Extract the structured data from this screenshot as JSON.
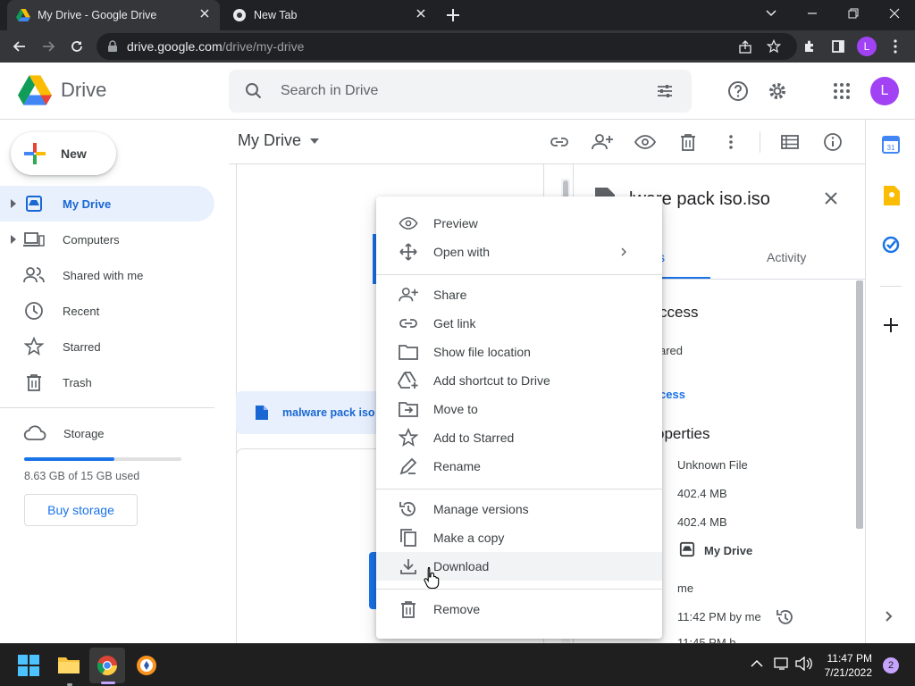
{
  "browser": {
    "tabs": [
      {
        "title": "My Drive - Google Drive"
      },
      {
        "title": "New Tab"
      }
    ],
    "url_host": "drive.google.com",
    "url_path": "/drive/my-drive",
    "profile_initial": "L"
  },
  "header": {
    "brand": "Drive",
    "search_placeholder": "Search in Drive",
    "avatar_initial": "L"
  },
  "sidebar": {
    "new_label": "New",
    "items": [
      {
        "label": "My Drive",
        "icon": "my-drive-icon",
        "selected": true
      },
      {
        "label": "Computers",
        "icon": "computers-icon"
      },
      {
        "label": "Shared with me",
        "icon": "shared-icon"
      },
      {
        "label": "Recent",
        "icon": "clock-icon"
      },
      {
        "label": "Starred",
        "icon": "star-icon"
      },
      {
        "label": "Trash",
        "icon": "trash-icon"
      }
    ],
    "storage_label": "Storage",
    "storage_used_text": "8.63 GB of 15 GB used",
    "storage_fraction": 0.575,
    "buy_storage": "Buy storage"
  },
  "main": {
    "title": "My Drive",
    "selected_file": "malware pack iso"
  },
  "details": {
    "title": "lware pack iso.iso",
    "tab_details_partial": "s",
    "tab_activity": "Activity",
    "access_heading": "ccess",
    "access_text": "ared",
    "access_link": "cess",
    "properties_heading": "operties",
    "type": "Unknown File",
    "size": "402.4 MB",
    "storage_used": "402.4 MB",
    "location": "My Drive",
    "owner": "me",
    "modified": "11:42 PM by me",
    "opened_partial": "11:45 PM b"
  },
  "context_menu": {
    "items": [
      {
        "label": "Preview",
        "icon": "eye-icon",
        "group": 0
      },
      {
        "label": "Open with",
        "icon": "open-with-icon",
        "group": 0,
        "submenu": true
      },
      {
        "label": "Share",
        "icon": "share-person-icon",
        "group": 1
      },
      {
        "label": "Get link",
        "icon": "link-icon",
        "group": 1
      },
      {
        "label": "Show file location",
        "icon": "folder-icon",
        "group": 1
      },
      {
        "label": "Add shortcut to Drive",
        "icon": "add-shortcut-icon",
        "group": 1
      },
      {
        "label": "Move to",
        "icon": "move-to-icon",
        "group": 1
      },
      {
        "label": "Add to Starred",
        "icon": "star-icon",
        "group": 1
      },
      {
        "label": "Rename",
        "icon": "rename-icon",
        "group": 1
      },
      {
        "label": "Manage versions",
        "icon": "versions-icon",
        "group": 2
      },
      {
        "label": "Make a copy",
        "icon": "copy-icon",
        "group": 2
      },
      {
        "label": "Download",
        "icon": "download-icon",
        "group": 2,
        "hover": true
      },
      {
        "label": "Remove",
        "icon": "trash-icon",
        "group": 3
      }
    ]
  },
  "taskbar": {
    "time": "11:47 PM",
    "date": "7/21/2022",
    "notifications": "2"
  }
}
